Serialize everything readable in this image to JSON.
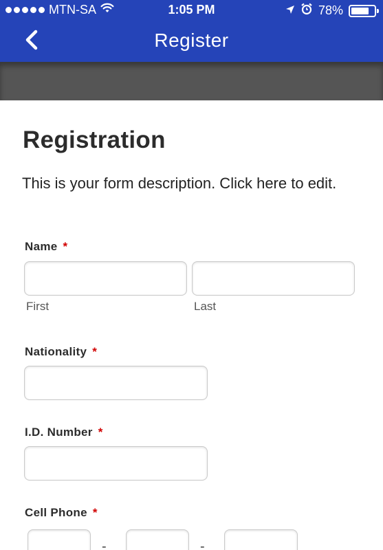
{
  "status_bar": {
    "carrier": "MTN-SA",
    "time": "1:05 PM",
    "battery": "78%",
    "battery_level": 0.78,
    "icons": [
      "signal-dots",
      "wifi-icon",
      "location-arrow-icon",
      "alarm-icon",
      "battery-icon"
    ]
  },
  "nav": {
    "title": "Register",
    "back_icon": "chevron-left-icon"
  },
  "form": {
    "title": "Registration",
    "description": "This is your form description. Click here to edit.",
    "required_mark": "*",
    "name": {
      "label": "Name",
      "first_sublabel": "First",
      "last_sublabel": "Last",
      "first_value": "",
      "last_value": ""
    },
    "nationality": {
      "label": "Nationality",
      "value": ""
    },
    "id_number": {
      "label": "I.D. Number",
      "value": ""
    },
    "cell_phone": {
      "label": "Cell Phone",
      "separator": "-",
      "part1": "",
      "part2": "",
      "part3": ""
    }
  },
  "colors": {
    "header": "#2544b8",
    "band": "#555555",
    "required": "#d10000"
  }
}
